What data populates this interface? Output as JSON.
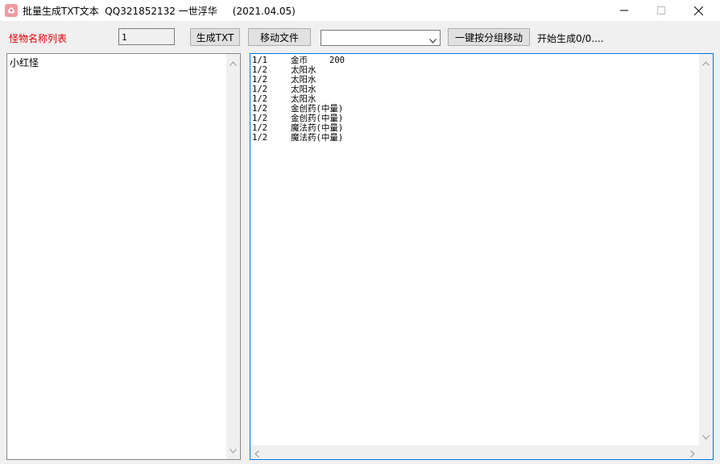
{
  "window": {
    "title": "批量生成TXT文本  QQ321852132 一世浮华     (2021.04.05)"
  },
  "toolbar": {
    "label": "怪物名称列表",
    "number_value": "1",
    "generate_label": "生成TXT",
    "move_label": "移动文件",
    "select_value": "",
    "group_move_label": "一键按分组移动",
    "status": "开始生成0/0...."
  },
  "monster_list": {
    "items": [
      "小红怪"
    ]
  },
  "output_lines": [
    {
      "ratio": "1/1",
      "item": "金币",
      "qty": "200"
    },
    {
      "ratio": "1/2",
      "item": "太阳水",
      "qty": ""
    },
    {
      "ratio": "1/2",
      "item": "太阳水",
      "qty": ""
    },
    {
      "ratio": "1/2",
      "item": "太阳水",
      "qty": ""
    },
    {
      "ratio": "1/2",
      "item": "太阳水",
      "qty": ""
    },
    {
      "ratio": "1/2",
      "item": "金创药(中量)",
      "qty": ""
    },
    {
      "ratio": "1/2",
      "item": "金创药(中量)",
      "qty": ""
    },
    {
      "ratio": "1/2",
      "item": "魔法药(中量)",
      "qty": ""
    },
    {
      "ratio": "1/2",
      "item": "魔法药(中量)",
      "qty": ""
    }
  ]
}
